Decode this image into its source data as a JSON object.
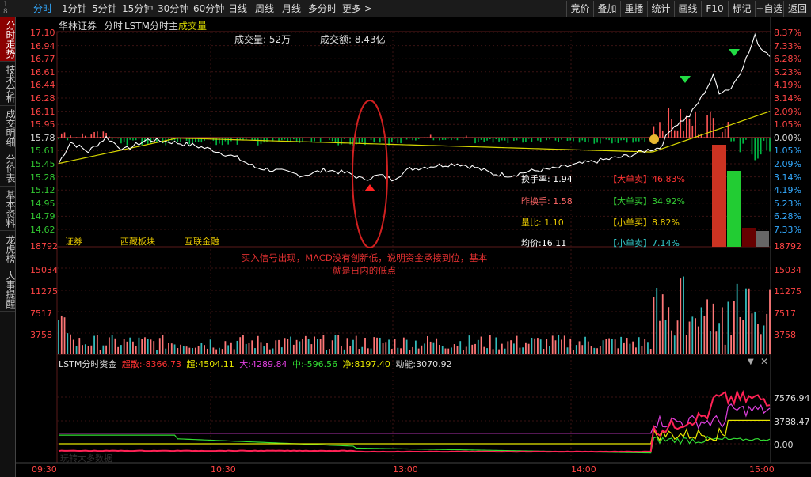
{
  "topbar": {
    "stock_code": "1\n8",
    "tabs": [
      "分时",
      "1分钟",
      "5分钟",
      "15分钟",
      "30分钟",
      "60分钟",
      "日线",
      "周线",
      "月线",
      "多分时",
      "更多"
    ],
    "more_arrow": ">",
    "right_buttons": [
      "竞价",
      "叠加",
      "重播",
      "统计",
      "画线",
      "F10",
      "标记",
      "+自选",
      "返回"
    ]
  },
  "leftbar": {
    "tabs": [
      "分时走势",
      "技术分析",
      "成交明细",
      "分价表",
      "基本资料",
      "龙虎榜",
      "大事提醒"
    ]
  },
  "header": {
    "stock_name": "华林证券",
    "mode": "分时",
    "indicator": "LSTM分时主",
    "volume_label": "成交量",
    "vol_summary": "成交量: 52万",
    "amount_summary": "成交额: 8.43亿"
  },
  "price_axis": [
    "17.10",
    "16.94",
    "16.77",
    "16.61",
    "16.44",
    "16.28",
    "16.11",
    "15.95",
    "15.78",
    "15.61",
    "15.45",
    "15.28",
    "15.12",
    "14.95",
    "14.79",
    "14.62"
  ],
  "pct_axis": [
    "8.37%",
    "7.33%",
    "6.28%",
    "5.23%",
    "4.19%",
    "3.14%",
    "2.09%",
    "1.05%",
    "0.00%",
    "1.05%",
    "2.09%",
    "3.14%",
    "4.19%",
    "5.23%",
    "6.28%",
    "7.33%"
  ],
  "vol_axis_left": [
    "18792",
    "15034",
    "11275",
    "7517",
    "3758"
  ],
  "vol_axis_right": [
    "18792",
    "15034",
    "11275",
    "7517",
    "3758"
  ],
  "fund_axis": [
    "7576.94",
    "3788.47",
    "0.00"
  ],
  "time_axis": [
    "09:30",
    "10:30",
    "13:00",
    "14:00",
    "15:00"
  ],
  "stats": {
    "turnover": "换手率: 1.94",
    "prev_turnover": "昨换手: 1.58",
    "volume_ratio": "量比: 1.10",
    "avg_price": "均价:16.11",
    "big_sell": "【大单卖】46.83%",
    "big_buy": "【大单买】34.92%",
    "small_buy": "【小单买】8.82%",
    "small_sell": "【小单卖】7.14%"
  },
  "sectors": [
    "证券",
    "西藏板块",
    "互联金融"
  ],
  "annotation": "买入信号出现，MACD没有创新低，说明资金承接到位，基本就是日内的低点",
  "fund_header": {
    "title": "LSTM分时资金",
    "super_label": "超:",
    "super_value": "4504.11",
    "big_label": "大:",
    "big_value": "4289.84",
    "mid_label": "中:",
    "mid_value": "-596.56",
    "net_label": "净:",
    "net_value": "8197.40",
    "power_label": "动能:",
    "power_value": "3070.92",
    "red_label": "超散:",
    "red_value": "-8366.73"
  },
  "watermark": "玩转大多数据",
  "colors": {
    "up": "#ff3333",
    "down": "#00cc33",
    "avg": "#d6d600",
    "price": "#ffffff",
    "cyan": "#33cccc",
    "accent_blue": "#33aaff"
  }
}
